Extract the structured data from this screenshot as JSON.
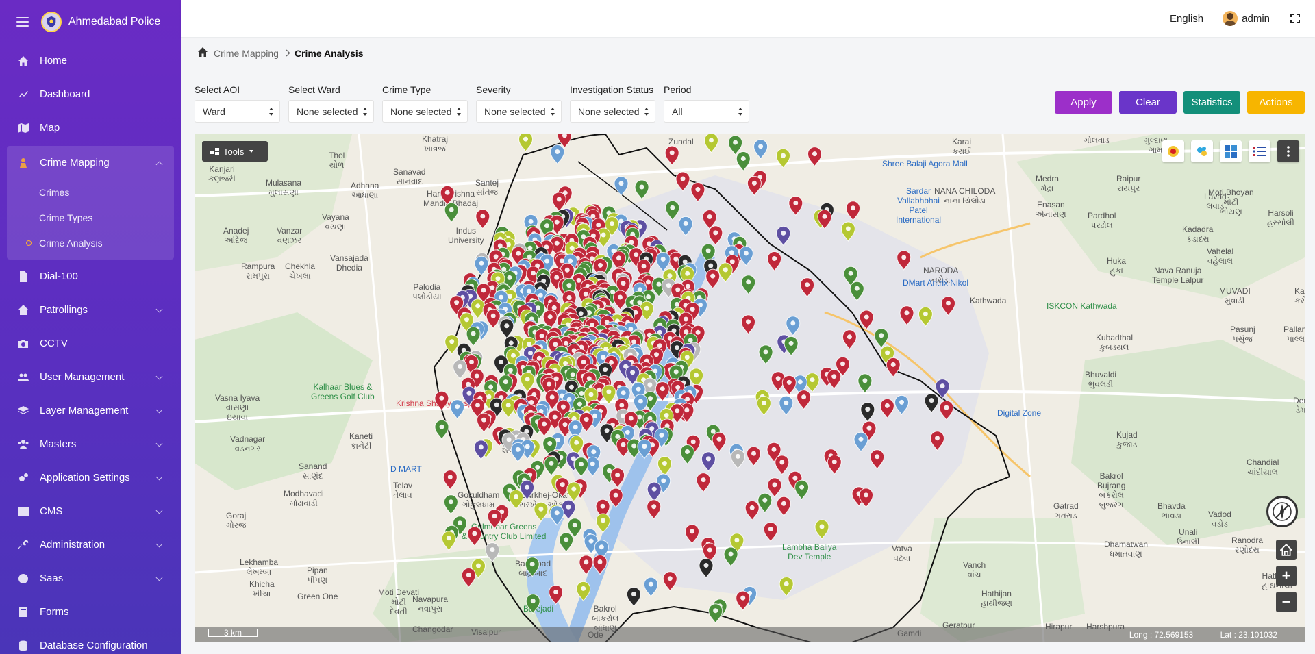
{
  "brand": {
    "title": "Ahmedabad Police"
  },
  "topbar": {
    "language": "English",
    "user": "admin"
  },
  "sidebar": {
    "items": [
      {
        "label": "Home",
        "icon": "home-icon"
      },
      {
        "label": "Dashboard",
        "icon": "chart-line-icon"
      },
      {
        "label": "Map",
        "icon": "map-icon"
      },
      {
        "label": "Crime Mapping",
        "icon": "person-icon",
        "expanded": true,
        "children": [
          {
            "label": "Crimes"
          },
          {
            "label": "Crime Types"
          },
          {
            "label": "Crime Analysis",
            "active": true
          }
        ]
      },
      {
        "label": "Dial-100",
        "icon": "file-icon"
      },
      {
        "label": "Patrollings",
        "icon": "pin-icon"
      },
      {
        "label": "CCTV",
        "icon": "camera-icon"
      },
      {
        "label": "User Management",
        "icon": "users-icon"
      },
      {
        "label": "Layer Management",
        "icon": "layers-icon"
      },
      {
        "label": "Masters",
        "icon": "group-icon"
      },
      {
        "label": "Application Settings",
        "icon": "cogs-icon"
      },
      {
        "label": "CMS",
        "icon": "cms-icon"
      },
      {
        "label": "Administration",
        "icon": "wrench-icon"
      },
      {
        "label": "Saas",
        "icon": "globe-icon"
      },
      {
        "label": "Forms",
        "icon": "form-icon"
      },
      {
        "label": "Database Configuration",
        "icon": "database-icon"
      }
    ]
  },
  "breadcrumb": {
    "parent": "Crime Mapping",
    "current": "Crime Analysis"
  },
  "filters": [
    {
      "label": "Select AOI",
      "value": "Ward"
    },
    {
      "label": "Select Ward",
      "value": "None selected"
    },
    {
      "label": "Crime Type",
      "value": "None selected"
    },
    {
      "label": "Severity",
      "value": "None selected"
    },
    {
      "label": "Investigation Status",
      "value": "None selected"
    },
    {
      "label": "Period",
      "value": "All"
    }
  ],
  "buttons": {
    "apply": "Apply",
    "clear": "Clear",
    "statistics": "Statistics",
    "actions": "Actions"
  },
  "map": {
    "tools_label": "Tools",
    "scale": "3 km",
    "longitude": "Long : 72.569153",
    "latitude": "Lat : 23.101032",
    "marker_colors": [
      "#c0283a",
      "#4a8f3a",
      "#b5c832",
      "#6a9fd4",
      "#5e4fa2",
      "#2a2a2a",
      "#b8b8b8"
    ],
    "labels": [
      "Khatraj\nખાત્રજ",
      "Zundal",
      "Karai\nકરાઈ",
      "ગોલવાડ",
      "ગુલ્દાણ\nગામ",
      "Kanjari\nકણજરી",
      "Thol\nથોળ",
      "Mulasana\nમુલાસણા",
      "Adhana\nઆધાણા",
      "Sanavad\nસાનવાદ",
      "Santej\nસાંતેજ",
      "Hare Krishna\nMandir, Bhadaj",
      "Shree Balaji Agora Mall",
      "Sardar\nVallabhbhai\nPatel\nInternational",
      "NANA CHILODA\nનાના ચિલોડા",
      "Medra\nમેદ્રા",
      "Raipur\nરાયપુર",
      "Moti Bhoyan\nમોટી\nભોયણ",
      "Vayana\nવયણા",
      "Indus\nUniversity",
      "Enasan\nએનાસણ",
      "Pardhol\nપરઢોલ",
      "Lavad\nલવાડ",
      "Harsoli\nહરસોલી",
      "Anadej\nઆંદેજ",
      "Vanzar\nવણઝર",
      "Kadadra\nકડાદરા",
      "Rampura\nરામપુરા",
      "Chekhla\nચેખલા",
      "Vansajada\nDhedia",
      "NARODA\nનરોડા",
      "Huka\nહુકા",
      "Vahelal\nવહેલાલ",
      "Nava Ranuja\nTemple Lalpur",
      "Palodia\nપલોડીયા",
      "Shilaj\nશીલજ",
      "DMart Antrix Nikol",
      "MUVADI\nમુવાડી",
      "Karoli\nકરોલી",
      "ISKCON Kathwada",
      "Kathwada",
      "Kubadthal\nકુબડથલ",
      "Pasunj\nપસુંજ",
      "Pallano Mel\nપાલ્લાનો મ",
      "Kalhaar Blues &\nGreens Golf Club",
      "Krishna Shalby Hospital",
      "Vasna Iyava\nવાસણા\nઇયાવા",
      "Bhuvaldi\nભુવલડી",
      "Demaliya\nડેમાલિયા",
      "Vadnagar\nવડનગર",
      "Kaneti\nકાનેટી",
      "Shela\nશેલા",
      "Digital Zone",
      "Kujad\nકુજાડ",
      "Chandial\nચાંદીયાલ",
      "Sanand\nસાણંદ",
      "D MART",
      "Telav\nતેલાવ",
      "Gokuldham\nગોકુલધામ",
      "Sarkhej-Okaf\nસરખેજ-ઓકાફ",
      "Modhavadi\nમોઢાવાડી",
      "Bakrol\nBujrang\nબકરોલ\nબુજરંગ",
      "Bhavda\nભાવડા",
      "Vadod\nવડોડ",
      "Goraj\nગોરજ",
      "Gulmohar Greens\n& Country Club Limited",
      "Gatrad\nગતરાડ",
      "Vatva\nવટવા",
      "Dhamatwan\nધમાતવાણ",
      "Unali\nઉનાલી",
      "Ranodra\nરણોદરા",
      "Lekhamba\nલેખમ્બા",
      "Pipan\nપીપણ",
      "Badrabad\nબાદ્રાબાદ",
      "Lambha Baliya\nDev Temple",
      "Navapura\nનવાપુરા",
      "Moti Devati\nમોટી\nદેવતી",
      "Vanch\nવાંચ",
      "Hathnoli\nહાથનોલી",
      "Khicha\nખીચા",
      "Green One",
      "Barejadi",
      "Bakrol\nબાકરોલ\nબાંધાણ",
      "Hathijan\nહાથીજણ",
      "Changodar",
      "Visalpur",
      "Ode",
      "Gamdi",
      "Geratpur",
      "Hirapur",
      "Harshpura"
    ]
  }
}
